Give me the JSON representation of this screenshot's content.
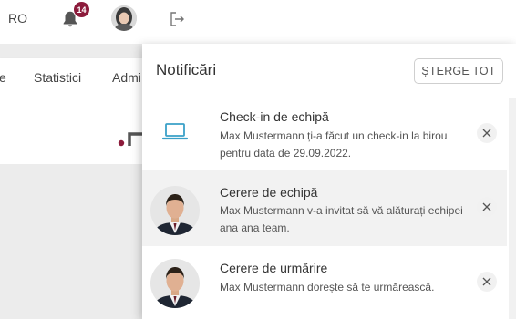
{
  "header": {
    "language": "RO",
    "notification_count": "14"
  },
  "nav": {
    "item_partial_left": "e",
    "item_statistici": "Statistici",
    "item_partial_admin": "Admi"
  },
  "notifications_panel": {
    "title": "Notificări",
    "clear_all_label": "ȘTERGE TOT",
    "items": [
      {
        "title": "Check-in de echipă",
        "text": "Max Mustermann ți-a făcut un check-in la birou pentru data de 29.09.2022.",
        "icon": "laptop-icon"
      },
      {
        "title": "Cerere de echipă",
        "text": "Max Mustermann v-a invitat să vă alăturați echipei ana ana team.",
        "icon": "user-avatar"
      },
      {
        "title": "Cerere de urmărire",
        "text": "Max Mustermann dorește să te urmărească.",
        "icon": "user-avatar"
      }
    ]
  },
  "colors": {
    "badge": "#8c1b3b",
    "laptop_icon": "#3aa0c8",
    "highlight_row": "#f2f2f2"
  }
}
